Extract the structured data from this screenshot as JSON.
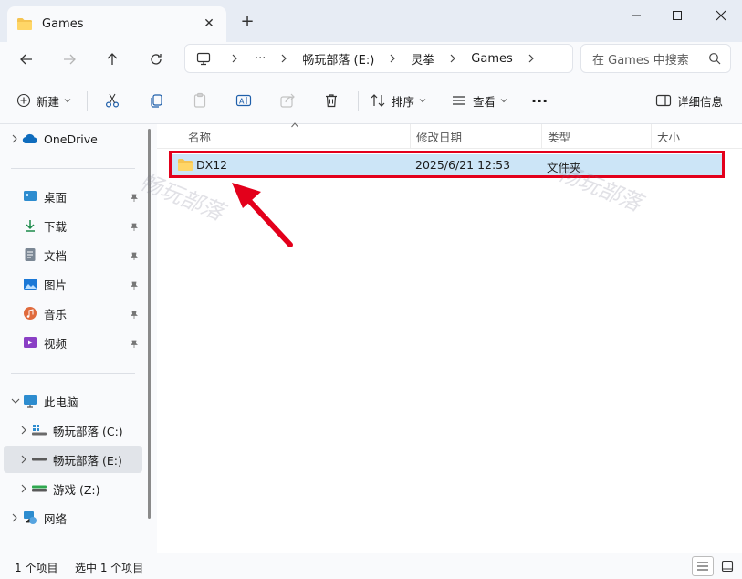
{
  "window": {
    "tab_title": "Games",
    "tab_close": "✕",
    "new_tab": "+"
  },
  "address": {
    "more": "···",
    "crumbs": [
      "畅玩部落 (E:)",
      "灵拳",
      "Games"
    ],
    "search_placeholder": "在 Games 中搜索"
  },
  "toolbar": {
    "new_label": "新建",
    "sort_label": "排序",
    "view_label": "查看",
    "more": "···",
    "details_label": "详细信息"
  },
  "sidebar": {
    "onedrive": "OneDrive",
    "quick": [
      {
        "label": "桌面",
        "icon": "desktop-icon"
      },
      {
        "label": "下载",
        "icon": "download-icon"
      },
      {
        "label": "文档",
        "icon": "document-icon"
      },
      {
        "label": "图片",
        "icon": "pictures-icon"
      },
      {
        "label": "音乐",
        "icon": "music-icon"
      },
      {
        "label": "视频",
        "icon": "video-icon"
      }
    ],
    "this_pc": "此电脑",
    "drives": [
      {
        "label": "畅玩部落 (C:)"
      },
      {
        "label": "畅玩部落 (E:)"
      },
      {
        "label": "游戏 (Z:)"
      }
    ],
    "network": "网络"
  },
  "columns": {
    "name": "名称",
    "modified": "修改日期",
    "type": "类型",
    "size": "大小"
  },
  "files": [
    {
      "name": "DX12",
      "modified": "2025/6/21 12:53",
      "type": "文件夹",
      "size": ""
    }
  ],
  "status": {
    "count": "1 个项目",
    "selected": "选中 1 个项目"
  },
  "watermark": "畅玩部落",
  "colors": {
    "accent": "#0067c0",
    "selection": "#cce5f7",
    "highlight_outline": "#e3001b",
    "folder": "#f5c451"
  }
}
